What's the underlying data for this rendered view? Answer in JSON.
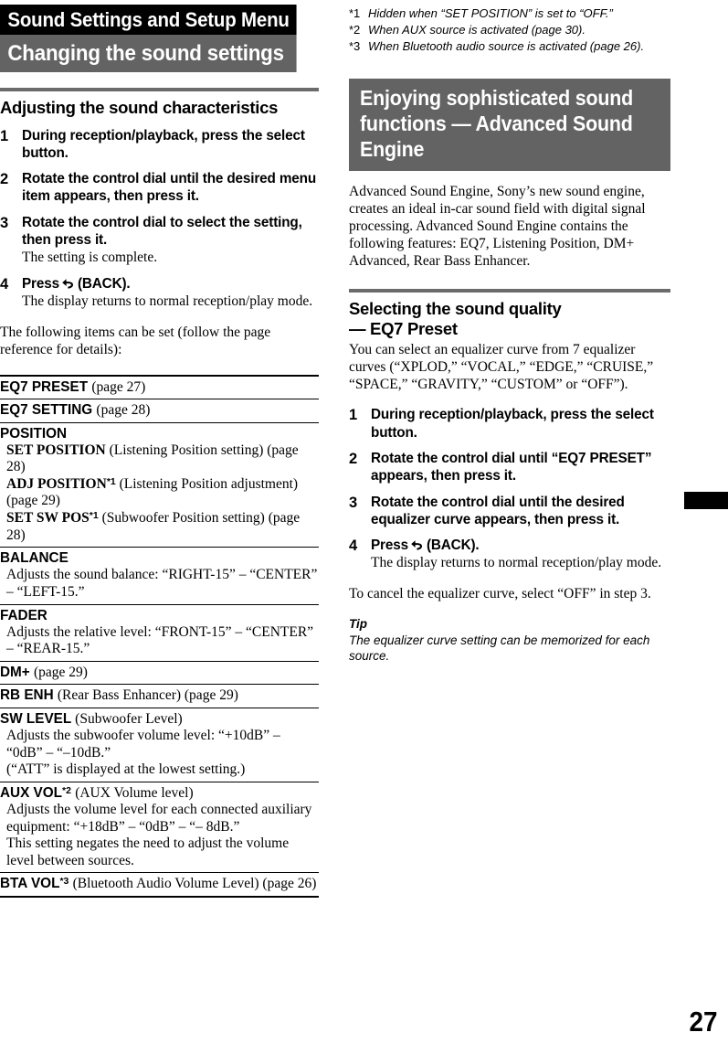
{
  "document": {
    "chapter_title": "Sound Settings and Setup Menu",
    "section_title": "Changing the sound settings",
    "page_number": "27"
  },
  "left_column": {
    "heading": "Adjusting the sound characteristics",
    "steps": [
      {
        "num": "1",
        "bold": "During reception/playback, press the select button.",
        "sub": ""
      },
      {
        "num": "2",
        "bold": "Rotate the control dial until the desired menu item appears, then press it.",
        "sub": ""
      },
      {
        "num": "3",
        "bold": "Rotate the control dial to select the setting, then press it.",
        "sub": "The setting is complete."
      },
      {
        "num": "4",
        "bold_before_icon": "Press",
        "icon": "back-arrow-icon",
        "bold_after_icon": "(BACK).",
        "sub": "The display returns to normal reception/play mode."
      }
    ],
    "intro_paragraph": "The following items can be set (follow the page reference for details):",
    "settings_rows": [
      {
        "term": "EQ7 PRESET",
        "term_paren": "(page 27)",
        "lines": []
      },
      {
        "term": "EQ7 SETTING",
        "term_paren": "(page 28)",
        "lines": []
      },
      {
        "term": "POSITION",
        "term_paren": "",
        "lines": [
          {
            "bold": "SET POSITION",
            "sup": "",
            "rest": " (Listening Position setting) (page 28)"
          },
          {
            "bold": "ADJ POSITION",
            "sup": "*1",
            "rest": " (Listening Position adjustment) (page 29)"
          },
          {
            "bold": "SET SW POS",
            "sup": "*1",
            "rest": " (Subwoofer Position setting) (page 28)"
          }
        ]
      },
      {
        "term": "BALANCE",
        "term_paren": "",
        "descriptions": [
          "Adjusts the sound balance: “RIGHT-15” – “CENTER” – “LEFT-15.”"
        ]
      },
      {
        "term": "FADER",
        "term_paren": "",
        "descriptions": [
          "Adjusts the relative level: “FRONT-15” – “CENTER” – “REAR-15.”"
        ]
      },
      {
        "term": "DM+",
        "term_paren": "(page 29)",
        "descriptions": []
      },
      {
        "term": "RB ENH",
        "term_paren": "(Rear Bass Enhancer) (page 29)",
        "descriptions": []
      },
      {
        "term": "SW LEVEL",
        "term_paren": "(Subwoofer Level)",
        "descriptions": [
          "Adjusts the subwoofer volume level: “+10dB” – “0dB” – “–10dB.”",
          "(“ATT” is displayed at the lowest setting.)"
        ]
      },
      {
        "term": "AUX VOL",
        "term_sup": "*2",
        "term_paren": "(AUX Volume level)",
        "descriptions": [
          "Adjusts the volume level for each connected auxiliary equipment: “+18dB” – “0dB” – “– 8dB.”",
          "This setting negates the need to adjust the volume level between sources."
        ]
      },
      {
        "term": "BTA VOL",
        "term_sup": "*3",
        "term_paren": "(Bluetooth Audio Volume Level) (page 26)",
        "descriptions": []
      }
    ]
  },
  "right_column": {
    "footnotes": [
      {
        "mark": "*1",
        "text": "Hidden when “SET POSITION” is set to “OFF.”"
      },
      {
        "mark": "*2",
        "text": "When AUX source is activated (page 30)."
      },
      {
        "mark": "*3",
        "text": "When Bluetooth audio source is activated (page 26)."
      }
    ],
    "gray_heading": "Enjoying sophisticated sound functions — Advanced Sound Engine",
    "intro_paragraph": "Advanced Sound Engine, Sony’s new sound engine, creates an ideal in-car sound field with digital signal processing. Advanced Sound Engine contains the following features: EQ7, Listening Position, DM+ Advanced, Rear Bass Enhancer.",
    "heading_line1": "Selecting the sound quality",
    "heading_line2": "— EQ7 Preset",
    "eq7_paragraph": "You can select an equalizer curve from 7 equalizer curves (“XPLOD,” “VOCAL,” “EDGE,” “CRUISE,” “SPACE,” “GRAVITY,” “CUSTOM” or “OFF”).",
    "steps": [
      {
        "num": "1",
        "bold": "During reception/playback, press the select button.",
        "sub": ""
      },
      {
        "num": "2",
        "bold": "Rotate the control dial until “EQ7 PRESET” appears, then press it.",
        "sub": ""
      },
      {
        "num": "3",
        "bold": "Rotate the control dial until the desired equalizer curve appears, then press it.",
        "sub": ""
      },
      {
        "num": "4",
        "bold_before_icon": "Press",
        "icon": "back-arrow-icon",
        "bold_after_icon": "(BACK).",
        "sub": "The display returns to normal reception/play mode."
      }
    ],
    "cancel_paragraph": "To cancel the equalizer curve, select “OFF” in step 3.",
    "tip_label": "Tip",
    "tip_text": "The equalizer curve setting can be memorized for each source."
  },
  "colors": {
    "chapter_bar_bg": "#000000",
    "section_bar_bg": "#636363",
    "gray_block_bg": "#636363",
    "rule": "#6b6b6b",
    "thumb_tab": "#000000"
  }
}
